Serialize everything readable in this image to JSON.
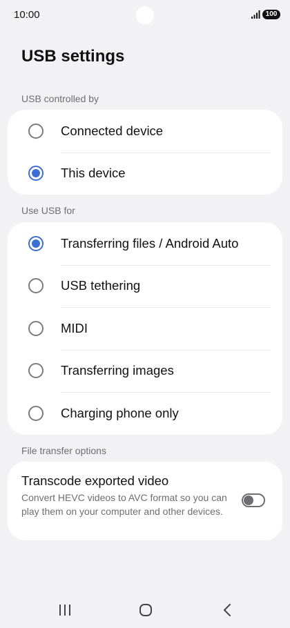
{
  "status_bar": {
    "time": "10:00",
    "battery": "100",
    "icons": [
      "signal-icon",
      "battery-icon"
    ]
  },
  "page": {
    "title": "USB settings"
  },
  "controlled_by": {
    "header": "USB controlled by",
    "options": [
      {
        "label": "Connected device",
        "selected": false
      },
      {
        "label": "This device",
        "selected": true
      }
    ]
  },
  "use_for": {
    "header": "Use USB for",
    "options": [
      {
        "label": "Transferring files / Android Auto",
        "selected": true
      },
      {
        "label": "USB tethering",
        "selected": false
      },
      {
        "label": "MIDI",
        "selected": false
      },
      {
        "label": "Transferring images",
        "selected": false
      },
      {
        "label": "Charging phone only",
        "selected": false
      }
    ]
  },
  "file_transfer": {
    "header": "File transfer options",
    "transcode": {
      "title": "Transcode exported video",
      "description": "Convert HEVC videos to AVC format so you can play them on your computer and other devices.",
      "enabled": false
    }
  },
  "nav_bar": {
    "icons": [
      "recents-icon",
      "home-icon",
      "back-icon"
    ]
  },
  "colors": {
    "accent": "#3b6fd6",
    "background": "#f2f2f4",
    "card": "#ffffff",
    "secondary_text": "#6e6e72"
  }
}
